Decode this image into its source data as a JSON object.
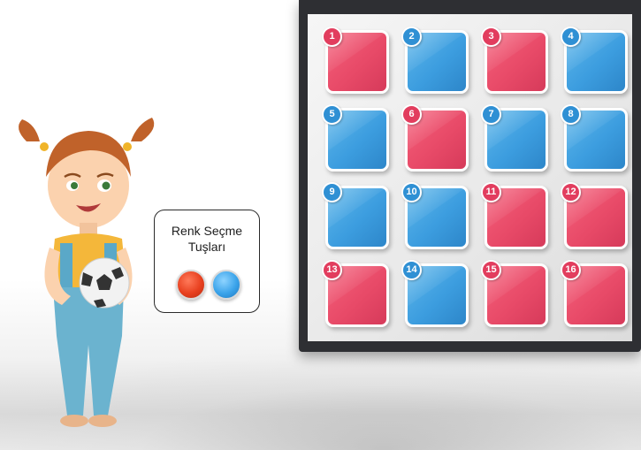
{
  "legend": {
    "title_line1": "Renk Seçme",
    "title_line2": "Tuşları",
    "buttons": [
      {
        "name": "red-color-button",
        "color": "#e8401f"
      },
      {
        "name": "blue-color-button",
        "color": "#3aa3ea"
      }
    ]
  },
  "grid": {
    "tiles": [
      {
        "number": "1",
        "color": "red"
      },
      {
        "number": "2",
        "color": "blue"
      },
      {
        "number": "3",
        "color": "red"
      },
      {
        "number": "4",
        "color": "blue"
      },
      {
        "number": "5",
        "color": "blue"
      },
      {
        "number": "6",
        "color": "red"
      },
      {
        "number": "7",
        "color": "blue"
      },
      {
        "number": "8",
        "color": "blue"
      },
      {
        "number": "9",
        "color": "blue"
      },
      {
        "number": "10",
        "color": "blue"
      },
      {
        "number": "11",
        "color": "red"
      },
      {
        "number": "12",
        "color": "red"
      },
      {
        "number": "13",
        "color": "red"
      },
      {
        "number": "14",
        "color": "blue"
      },
      {
        "number": "15",
        "color": "red"
      },
      {
        "number": "16",
        "color": "red"
      }
    ]
  },
  "colors": {
    "red": "#e84a68",
    "blue": "#3c9ddf",
    "monitor_frame": "#2e2f33"
  }
}
